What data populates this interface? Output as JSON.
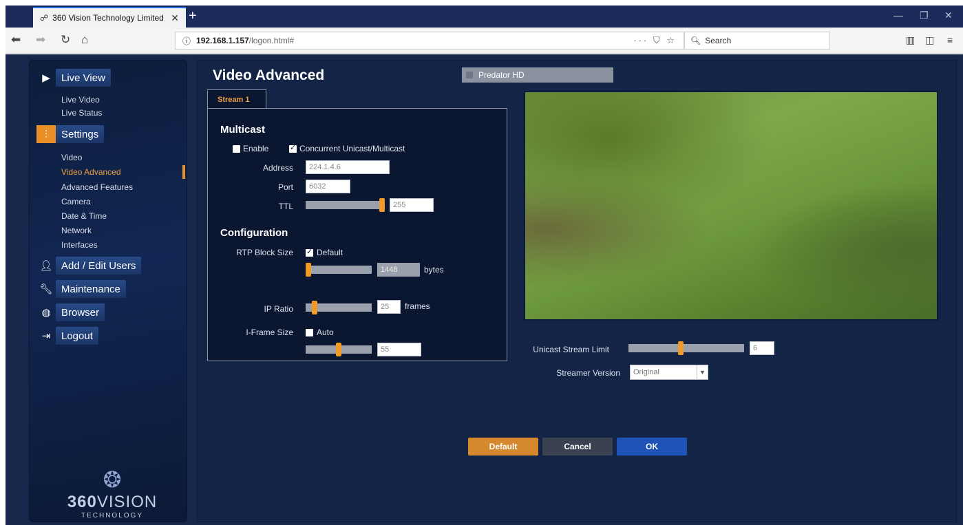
{
  "browser": {
    "tab_title": "360 Vision Technology Limited",
    "tab_close": "✕",
    "new_tab": "+",
    "url_host": "192.168.1.157",
    "url_path": "/logon.html#",
    "url_actions": "···",
    "search_placeholder": "Search"
  },
  "sidebar": {
    "live_view": "Live View",
    "live_items": [
      "Live Video",
      "Live Status"
    ],
    "settings": "Settings",
    "settings_items": [
      "Video",
      "Video Advanced",
      "Advanced Features",
      "Camera",
      "Date & Time",
      "Network",
      "Interfaces"
    ],
    "active_item": "Video Advanced",
    "add_edit_users": "Add / Edit Users",
    "maintenance": "Maintenance",
    "browser": "Browser",
    "logout": "Logout",
    "logo_main_bold": "360",
    "logo_main_rest": "VISION",
    "logo_sub": "TECHNOLOGY"
  },
  "page": {
    "title": "Video Advanced",
    "camera_name": "Predator HD",
    "stream_tab": "Stream 1"
  },
  "multicast": {
    "heading": "Multicast",
    "enable_label": "Enable",
    "enable_checked": false,
    "concurrent_label": "Concurrent Unicast/Multicast",
    "concurrent_checked": true,
    "address_label": "Address",
    "address_value": "224.1.4.6",
    "port_label": "Port",
    "port_value": "6032",
    "ttl_label": "TTL",
    "ttl_value": "255",
    "ttl_fraction": 1.0
  },
  "configuration": {
    "heading": "Configuration",
    "rtp_label": "RTP Block Size",
    "rtp_default_label": "Default",
    "rtp_default_checked": true,
    "rtp_value": "1448",
    "rtp_unit": "bytes",
    "rtp_fraction": 0.0,
    "ip_ratio_label": "IP Ratio",
    "ip_ratio_value": "25",
    "ip_ratio_unit": "frames",
    "ip_ratio_fraction": 0.1,
    "iframe_label": "I-Frame Size",
    "iframe_auto_label": "Auto",
    "iframe_auto_checked": false,
    "iframe_value": "55",
    "iframe_fraction": 0.5
  },
  "stream_settings": {
    "unicast_limit_label": "Unicast Stream Limit",
    "unicast_limit_value": "6",
    "unicast_limit_fraction": 0.45,
    "streamer_version_label": "Streamer Version",
    "streamer_version_value": "Original"
  },
  "buttons": {
    "default": "Default",
    "cancel": "Cancel",
    "ok": "OK"
  },
  "colors": {
    "accent_orange": "#e88f28",
    "ok_blue": "#1f53b8",
    "cancel_grey": "#3a4252",
    "default_orange": "#d6892c"
  }
}
